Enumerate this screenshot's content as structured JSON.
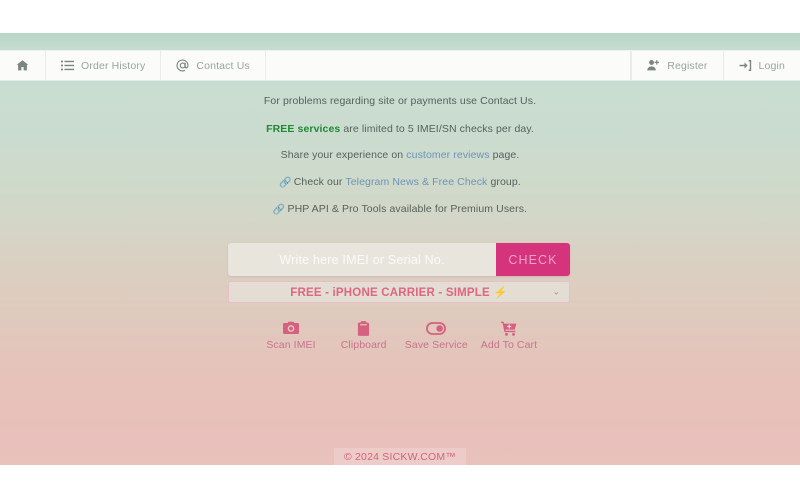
{
  "navbar": {
    "left_items": [
      {
        "label": "",
        "icon": "home-icon",
        "name": "nav-home"
      },
      {
        "label": "Order History",
        "icon": "list-icon",
        "name": "nav-order-history"
      },
      {
        "label": "Contact Us",
        "icon": "at-sign-icon",
        "name": "nav-contact-us"
      }
    ],
    "right_items": [
      {
        "label": "Register",
        "icon": "user-plus-icon",
        "name": "nav-register"
      },
      {
        "label": "Login",
        "icon": "sign-in-icon",
        "name": "nav-login"
      }
    ]
  },
  "info": {
    "line1": "For problems regarding site or payments use Contact Us.",
    "line2_strong": "FREE services",
    "line2_rest": " are limited to 5 IMEI/SN checks per day.",
    "line3_pre": "Share your experience on ",
    "line3_link": "customer reviews",
    "line3_post": " page.",
    "line4_pre": "Check our ",
    "line4_link": "Telegram News & Free Check",
    "line4_post": " group.",
    "line5": "PHP API & Pro Tools available for Premium Users.",
    "link_icon": "link-chain-icon"
  },
  "search": {
    "placeholder": "Write here IMEI or Serial No.",
    "value": "",
    "button_label": "CHECK",
    "button_color": "#d5337c"
  },
  "service": {
    "selected": "FREE - iPHONE CARRIER - SIMPLE",
    "badge": "⚡",
    "chevron": "⌄",
    "text_color": "#e0667f"
  },
  "actions": [
    {
      "label": "Scan IMEI",
      "icon": "camera-icon",
      "name": "scan-imei-button"
    },
    {
      "label": "Clipboard",
      "icon": "clipboard-icon",
      "name": "clipboard-button"
    },
    {
      "label": "Save Service",
      "icon": "toggle-icon",
      "name": "save-service-button"
    },
    {
      "label": "Add To Cart",
      "icon": "cart-plus-icon",
      "name": "add-to-cart-button"
    }
  ],
  "footer": {
    "copyright": "© 2024 SICKW.COM™"
  },
  "theme": {
    "gradient_top": "#c6dcd0",
    "gradient_bottom": "#e9c0bb",
    "accent_pink": "#d5337c",
    "link_blue": "#6f93b8",
    "free_green": "#1f8a32"
  }
}
